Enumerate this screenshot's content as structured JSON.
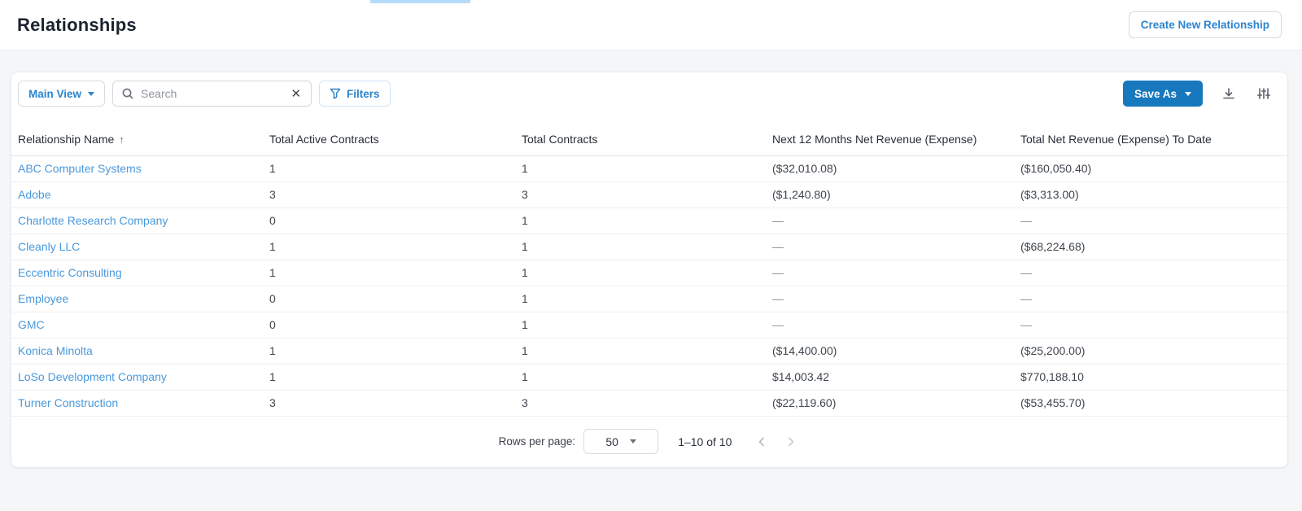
{
  "page": {
    "title": "Relationships",
    "create_button_label": "Create New Relationship"
  },
  "toolbar": {
    "view_selector_label": "Main View",
    "search_placeholder": "Search",
    "search_value": "",
    "filters_label": "Filters",
    "save_as_label": "Save As"
  },
  "icons": {
    "sort_ascending": "↑",
    "clear_search": "✕"
  },
  "table": {
    "columns": {
      "name": "Relationship Name",
      "active": "Total Active Contracts",
      "total": "Total Contracts",
      "next12": "Next 12 Months Net Revenue (Expense)",
      "toDate": "Total Net Revenue (Expense) To Date"
    },
    "sorted_column": "Relationship Name",
    "sort_direction": "ascending",
    "rows": [
      {
        "name": "ABC Computer Systems",
        "active": "1",
        "total": "1",
        "next12": "($32,010.08)",
        "toDate": "($160,050.40)"
      },
      {
        "name": "Adobe",
        "active": "3",
        "total": "3",
        "next12": "($1,240.80)",
        "toDate": "($3,313.00)"
      },
      {
        "name": "Charlotte Research Company",
        "active": "0",
        "total": "1",
        "next12": "—",
        "toDate": "—"
      },
      {
        "name": "Cleanly LLC",
        "active": "1",
        "total": "1",
        "next12": "—",
        "toDate": "($68,224.68)"
      },
      {
        "name": "Eccentric Consulting",
        "active": "1",
        "total": "1",
        "next12": "—",
        "toDate": "—"
      },
      {
        "name": "Employee",
        "active": "0",
        "total": "1",
        "next12": "—",
        "toDate": "—"
      },
      {
        "name": "GMC",
        "active": "0",
        "total": "1",
        "next12": "—",
        "toDate": "—"
      },
      {
        "name": "Konica Minolta",
        "active": "1",
        "total": "1",
        "next12": "($14,400.00)",
        "toDate": "($25,200.00)"
      },
      {
        "name": "LoSo Development Company",
        "active": "1",
        "total": "1",
        "next12": "$14,003.42",
        "toDate": "$770,188.10"
      },
      {
        "name": "Turner Construction",
        "active": "3",
        "total": "3",
        "next12": "($22,119.60)",
        "toDate": "($53,455.70)"
      }
    ]
  },
  "pagination": {
    "rows_per_page_label": "Rows per page:",
    "rows_per_page_value": "50",
    "range_label": "1–10 of 10"
  },
  "colors": {
    "accent_blue": "#2b84cd",
    "link_blue": "#4a99dc",
    "save_as_bg": "#1878be",
    "page_bg": "#f5f6f8",
    "top_strip": "#b5dcf8"
  }
}
